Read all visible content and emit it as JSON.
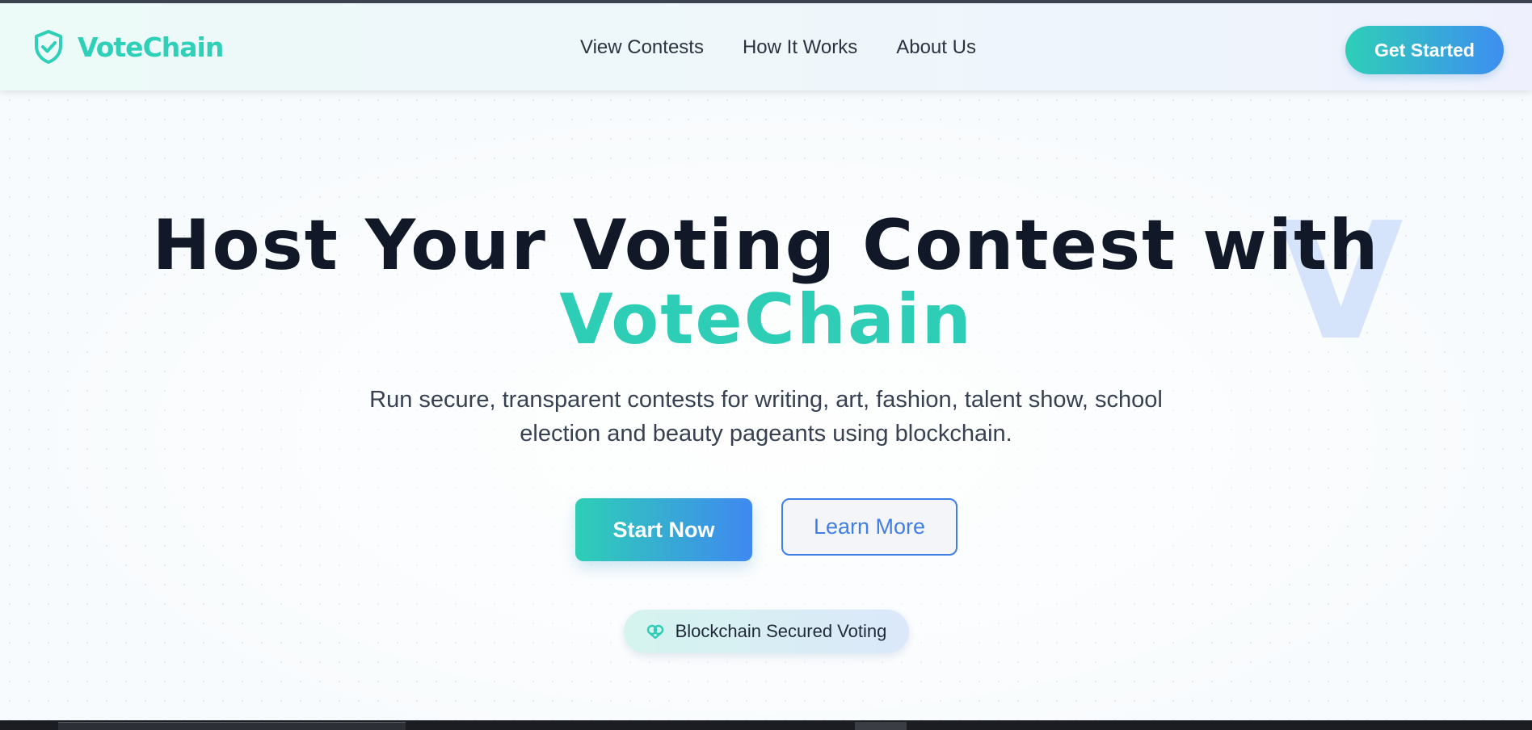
{
  "brand": {
    "name": "VoteChain",
    "logo_icon": "shield-check-icon",
    "accent_color": "#2ecdb6",
    "gradient_end": "#3f88f0"
  },
  "nav": {
    "links": [
      {
        "label": "View Contests"
      },
      {
        "label": "How It Works"
      },
      {
        "label": "About Us"
      }
    ],
    "cta_label": "Get Started"
  },
  "hero": {
    "title_line1": "Host Your Voting Contest with",
    "title_accent": "VoteChain",
    "watermark": "V",
    "subtitle": "Run secure, transparent contests for writing, art, fashion, talent show, school election and beauty pageants using blockchain.",
    "primary_button": "Start Now",
    "secondary_button": "Learn More",
    "badge": {
      "icon": "heart-link-icon",
      "label": "Blockchain Secured Voting"
    }
  }
}
